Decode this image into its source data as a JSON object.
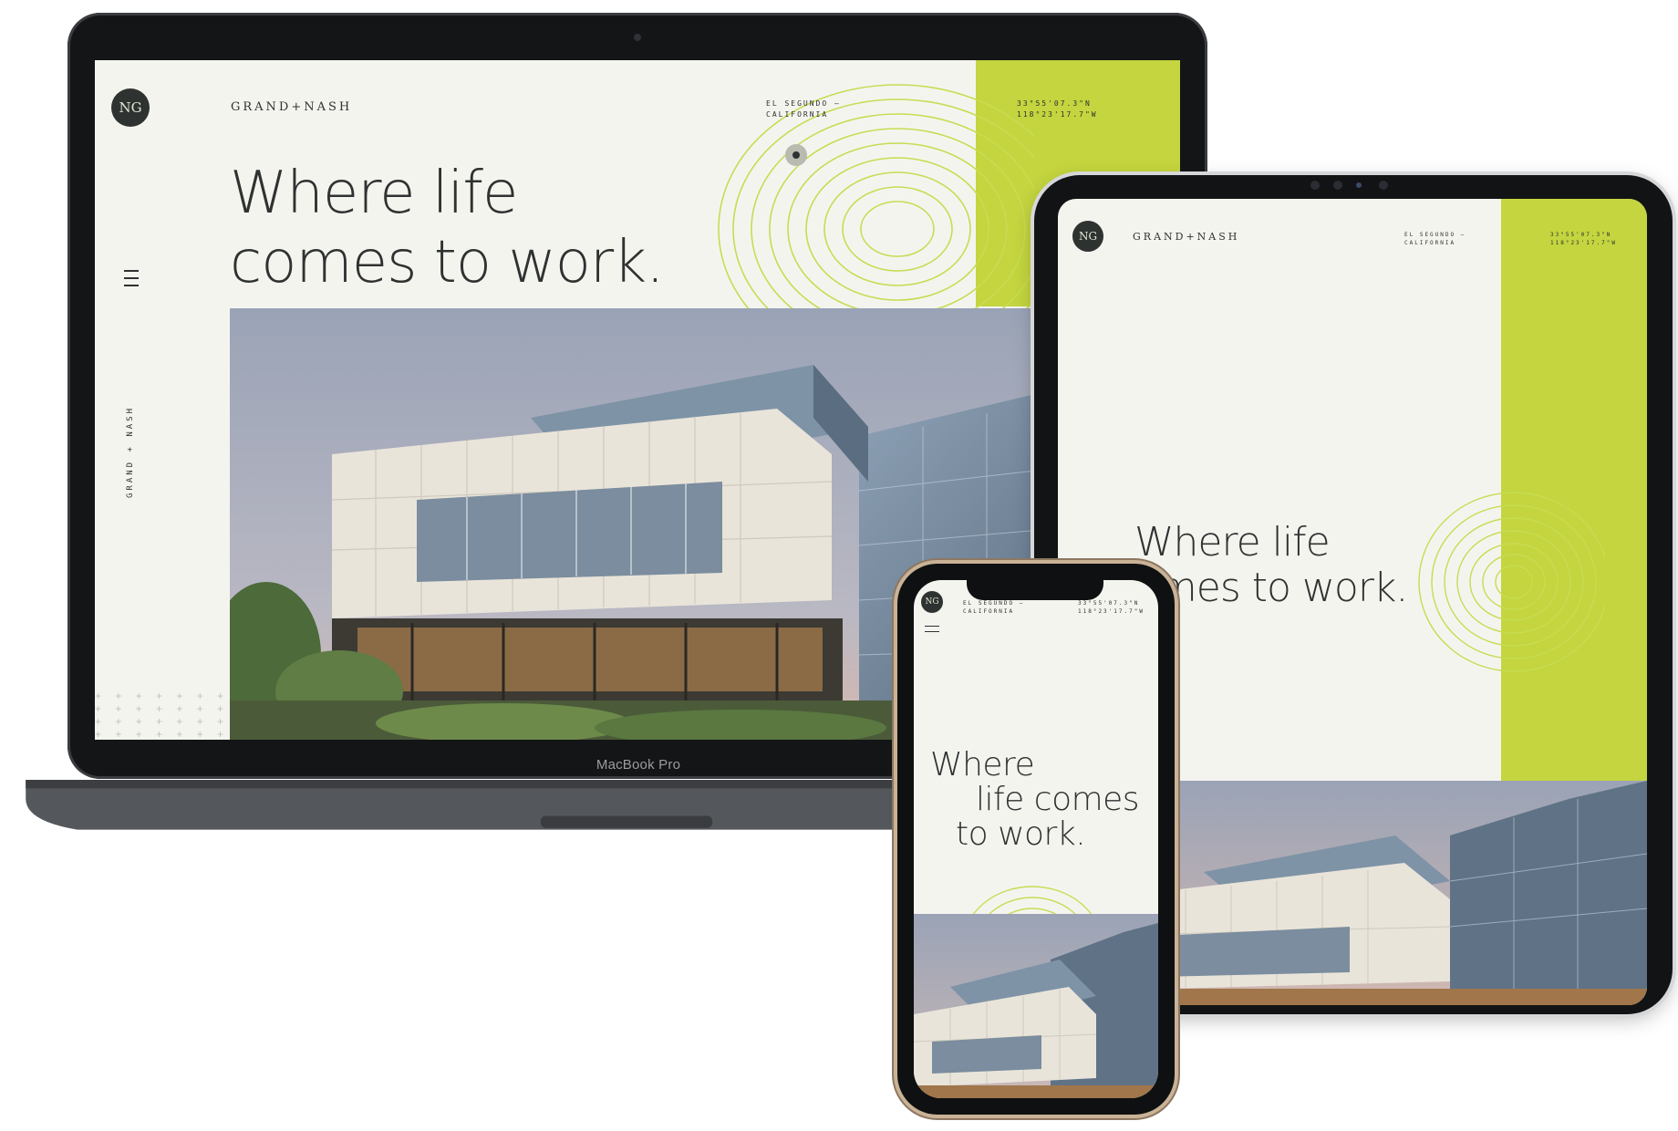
{
  "site": {
    "logo_text": "NG",
    "wordmark": "GRAND+NASH",
    "location_line1": "EL SEGUNDO —",
    "location_line2": "CALIFORNIA",
    "coord_line1": "33°55'07.3\"N",
    "coord_line2": "118°23'17.7\"W",
    "vertical_label": "GRAND + NASH",
    "headline_line1": "Where life",
    "headline_line2": "comes to work."
  },
  "phone_site": {
    "location_line1": "EL SEGUNDO —",
    "location_line2": "CALIFORNIA",
    "coord_line1": "33°55'07.3\"N",
    "coord_line2": "118°23'17.7\"W",
    "headline_line1": "Where",
    "headline_line2": "life comes",
    "headline_line3": "to work."
  },
  "laptop": {
    "brand_label": "MacBook Pro"
  },
  "tablet_site": {
    "headline_line1": "Where life",
    "headline_line2": "omes to work."
  },
  "decor": {
    "plus_pattern": "+ + + + + + + + + + + + + + + + + + + + + + + + + + + + + + + + + + + + + + + + + + + + + + + + + + + + + + + + + + + + + + + + + + + + + + + + + + + + + + + + + + +"
  },
  "colors": {
    "accent_green": "#c4d53f",
    "contour_green": "#c7dc52",
    "ink": "#2e3230",
    "paper": "#f4f4ef"
  },
  "icons": {
    "menu": "hamburger-menu-icon",
    "logo": "monogram-logo"
  }
}
